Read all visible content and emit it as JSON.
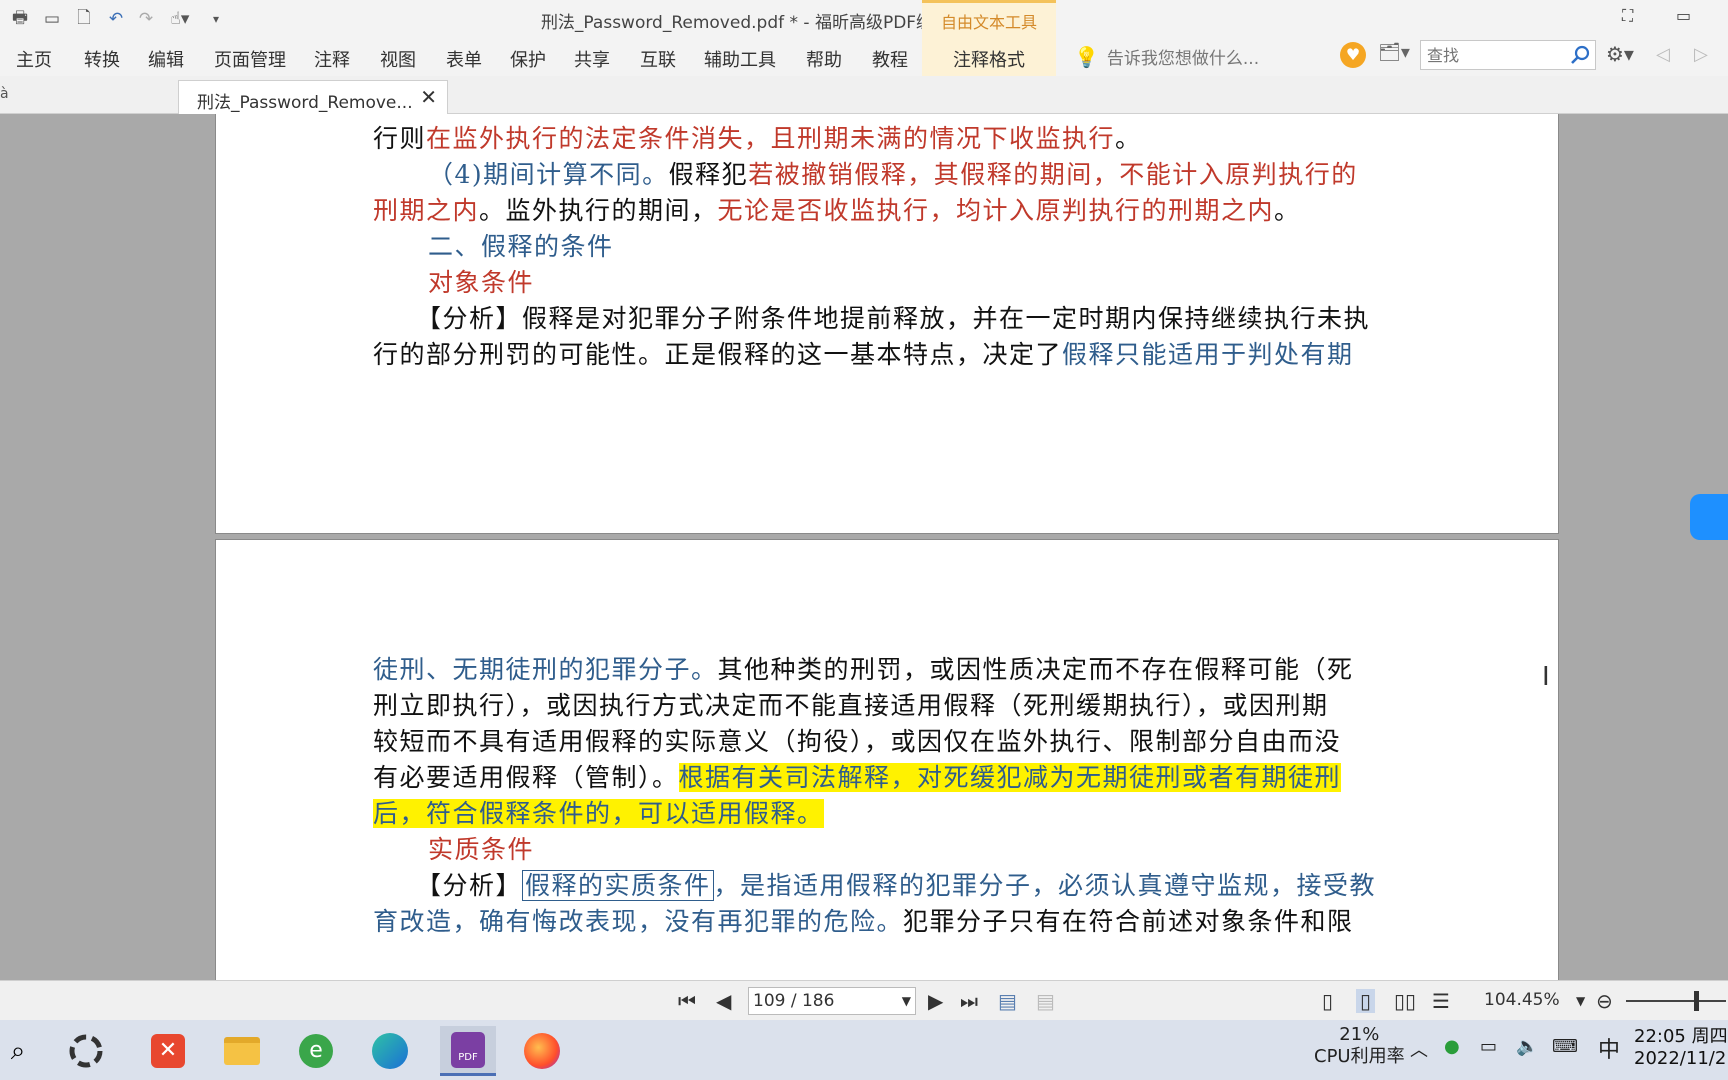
{
  "window": {
    "title": "刑法_Password_Removed.pdf * - 福昕高级PDF编辑器",
    "context_tab_header": "自由文本工具"
  },
  "ribbon": {
    "tabs": [
      "主页",
      "转换",
      "编辑",
      "页面管理",
      "注释",
      "视图",
      "表单",
      "保护",
      "共享",
      "互联",
      "辅助工具",
      "帮助",
      "教程"
    ],
    "context_tab": "注释格式",
    "tell_me": "告诉我您想做什么...",
    "search_placeholder": "查找"
  },
  "doc_tab": {
    "label": "刑法_Password_Remove...",
    "close": "✕",
    "prev_tab_fragment": "à"
  },
  "page1_lines": {
    "l1_a": "行则",
    "l1_b": "在监外执行的法定条件消失，且刑期未满的情况下收监执行",
    "l1_c": "。",
    "l2_a": "（4)期间计算不同。",
    "l2_b": "假释犯",
    "l2_c": "若被撤销假释，其假释的期间，不能计入原判执行的",
    "l3_a": "刑期之内",
    "l3_b": "。监外执行的期间，",
    "l3_c": "无论是否收监执行，均计入原判执行的刑期之内",
    "l3_d": "。",
    "l4": "二、假释的条件",
    "l5": "对象条件",
    "l6": "【分析】假释是对犯罪分子附条件地提前释放，并在一定时期内保持继续执行未执",
    "l7_a": "行的部分刑罚的可能性。正是假释的这一基本特点，决定了",
    "l7_b": "假释只能适用于判处有期"
  },
  "page2_lines": {
    "l1_a": "徒刑、无期徒刑的犯罪分子。",
    "l1_b": "其他种类的刑罚，或因性质决定而不存在假释可能（死",
    "l2": "刑立即执行），或因执行方式决定而不能直接适用假释（死刑缓期执行），或因刑期",
    "l3": "较短而不具有适用假释的实际意义（拘役），或因仅在监外执行、限制部分自由而没",
    "l4_a": "有必要适用假释（管制）。",
    "l4_b": "根据有关司法解释，对死缓犯减为无期徒刑或者有期徒刑",
    "l5": "后，符合假释条件的，可以适用假释。",
    "l6": "实质条件",
    "l7_a": "【分析】",
    "l7_b": "假释的实质条件",
    "l7_c": "，是指适用假释的犯罪分子，必须认真遵守监规，接受教",
    "l8_a": "育改造，确有悔改表现，没有再犯罪的危险。",
    "l8_b": "犯罪分子只有在符合前述对象条件和限"
  },
  "statusbar": {
    "page_indicator": "109 / 186",
    "zoom": "104.45%"
  },
  "taskbar": {
    "cpu_pct": "21%",
    "cpu_label": "CPU利用率",
    "ime": "中",
    "time": "22:05 周四",
    "date": "2022/11/2"
  },
  "colors": {
    "red_text": "#c0392b",
    "blue_text": "#2f5d8c",
    "highlight": "#fff200",
    "context_tab": "#fdf2d6"
  }
}
